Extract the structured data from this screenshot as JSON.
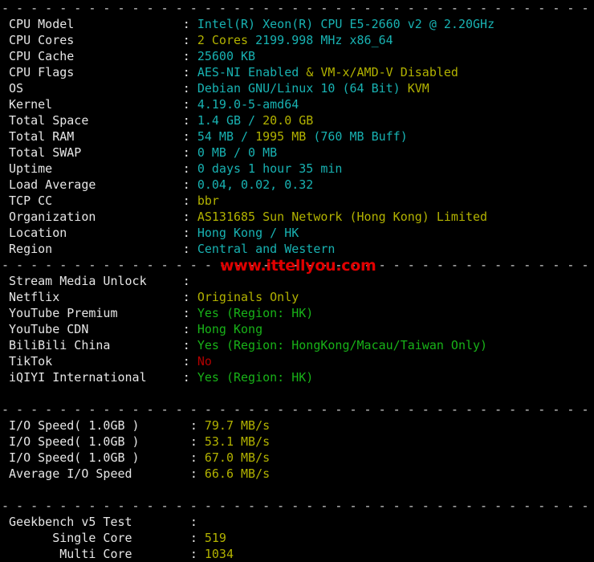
{
  "terminal": {
    "separator": "- - - - - - - - - - - - - - - - - - - - - - - - - - - - - - - - - - - - - - - - - -",
    "watermark": "www.ittellyou.com",
    "colon": ":",
    "colors": {
      "background": "#000000",
      "label": "#e6e6e6",
      "cyan": "#18b2b2",
      "yellow": "#b2b200",
      "green": "#18b218",
      "red": "#b20000",
      "watermark": "#e00000"
    }
  },
  "sections": {
    "system": [
      {
        "label": "CPU Model",
        "parts": [
          {
            "text": "Intel(R) Xeon(R) CPU E5-2660 v2 @ 2.20GHz",
            "color": "cyan"
          }
        ]
      },
      {
        "label": "CPU Cores",
        "parts": [
          {
            "text": "2 Cores ",
            "color": "yellow"
          },
          {
            "text": "2199.998 MHz x86_64",
            "color": "cyan"
          }
        ]
      },
      {
        "label": "CPU Cache",
        "parts": [
          {
            "text": "25600 KB",
            "color": "cyan"
          }
        ]
      },
      {
        "label": "CPU Flags",
        "parts": [
          {
            "text": "AES-NI Enabled ",
            "color": "cyan"
          },
          {
            "text": "& VM-x/AMD-V Disabled",
            "color": "yellow"
          }
        ]
      },
      {
        "label": "OS",
        "parts": [
          {
            "text": "Debian GNU/Linux 10 (64 Bit) ",
            "color": "cyan"
          },
          {
            "text": "KVM",
            "color": "yellow"
          }
        ]
      },
      {
        "label": "Kernel",
        "parts": [
          {
            "text": "4.19.0-5-amd64",
            "color": "cyan"
          }
        ]
      },
      {
        "label": "Total Space",
        "parts": [
          {
            "text": "1.4 GB / ",
            "color": "cyan"
          },
          {
            "text": "20.0 GB",
            "color": "yellow"
          }
        ]
      },
      {
        "label": "Total RAM",
        "parts": [
          {
            "text": "54 MB / ",
            "color": "cyan"
          },
          {
            "text": "1995 MB ",
            "color": "yellow"
          },
          {
            "text": "(760 MB Buff)",
            "color": "cyan"
          }
        ]
      },
      {
        "label": "Total SWAP",
        "parts": [
          {
            "text": "0 MB / 0 MB",
            "color": "cyan"
          }
        ]
      },
      {
        "label": "Uptime",
        "parts": [
          {
            "text": "0 days 1 hour 35 min",
            "color": "cyan"
          }
        ]
      },
      {
        "label": "Load Average",
        "parts": [
          {
            "text": "0.04, 0.02, 0.32",
            "color": "cyan"
          }
        ]
      },
      {
        "label": "TCP CC",
        "parts": [
          {
            "text": "bbr",
            "color": "yellow"
          }
        ]
      },
      {
        "label": "Organization",
        "parts": [
          {
            "text": "AS131685 Sun Network (Hong Kong) Limited",
            "color": "yellow"
          }
        ]
      },
      {
        "label": "Location",
        "parts": [
          {
            "text": "Hong Kong / HK",
            "color": "cyan"
          }
        ]
      },
      {
        "label": "Region",
        "parts": [
          {
            "text": "Central and Western",
            "color": "cyan"
          }
        ]
      }
    ],
    "stream": [
      {
        "label": "Stream Media Unlock",
        "parts": []
      },
      {
        "label": "Netflix",
        "parts": [
          {
            "text": "Originals Only",
            "color": "yellow"
          }
        ]
      },
      {
        "label": "YouTube Premium",
        "parts": [
          {
            "text": "Yes (Region: HK)",
            "color": "green"
          }
        ]
      },
      {
        "label": "YouTube CDN",
        "parts": [
          {
            "text": "Hong Kong",
            "color": "green"
          }
        ]
      },
      {
        "label": "BiliBili China",
        "parts": [
          {
            "text": "Yes (Region: HongKong/Macau/Taiwan Only)",
            "color": "green"
          }
        ]
      },
      {
        "label": "TikTok",
        "parts": [
          {
            "text": "No",
            "color": "red"
          }
        ]
      },
      {
        "label": "iQIYI International",
        "parts": [
          {
            "text": "Yes (Region: HK)",
            "color": "green"
          }
        ]
      }
    ],
    "io": [
      {
        "label": "I/O Speed( 1.0GB )",
        "parts": [
          {
            "text": "79.7 MB/s",
            "color": "yellow"
          }
        ]
      },
      {
        "label": "I/O Speed( 1.0GB )",
        "parts": [
          {
            "text": "53.1 MB/s",
            "color": "yellow"
          }
        ]
      },
      {
        "label": "I/O Speed( 1.0GB )",
        "parts": [
          {
            "text": "67.0 MB/s",
            "color": "yellow"
          }
        ]
      },
      {
        "label": "Average I/O Speed",
        "parts": [
          {
            "text": "66.6 MB/s",
            "color": "yellow"
          }
        ]
      }
    ],
    "geekbench": [
      {
        "label": "Geekbench v5 Test",
        "parts": []
      },
      {
        "label": "      Single Core",
        "parts": [
          {
            "text": "519",
            "color": "yellow"
          }
        ]
      },
      {
        "label": "       Multi Core",
        "parts": [
          {
            "text": "1034",
            "color": "yellow"
          }
        ]
      }
    ]
  }
}
